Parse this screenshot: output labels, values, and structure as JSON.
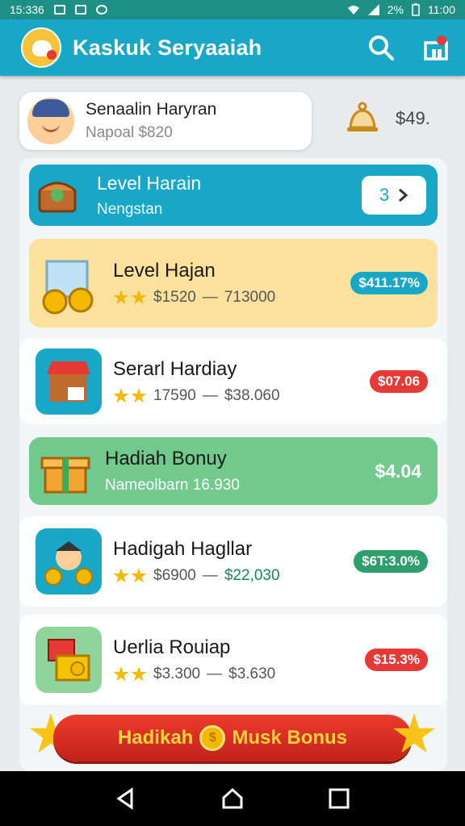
{
  "status_bar": {
    "time_left": "15:336",
    "battery": "2%",
    "time_right": "11:00"
  },
  "app_bar": {
    "title": "Kaskuk Seryaaiah"
  },
  "profile": {
    "name": "Senaalin Haryran",
    "subtitle": "Napoal $820"
  },
  "balance": {
    "value": "$49."
  },
  "rows": [
    {
      "title": "Level Harain",
      "subtitle": "Nengstan",
      "badge": "3",
      "bg": "#19a7c7"
    },
    {
      "title": "Level Hajan",
      "range_low": "$1520",
      "range_high": "713000",
      "pill": "$411.17%",
      "pill_color": "#19a7c7",
      "bg": "#fbe19b"
    },
    {
      "title": "Serarl Hardiay",
      "range_low": "17590",
      "range_high": "$38.060",
      "pill": "$07.06",
      "pill_color": "#e53935"
    },
    {
      "title": "Hadiah Bonuy",
      "subtitle": "Nameolbarn 16.930",
      "value": "$4.04",
      "bg": "#72c98d"
    },
    {
      "title": "Hadigah Hagllar",
      "range_low": "$6900",
      "range_high": "$22,030",
      "pill": "$6T:3.0%",
      "pill_color": "#2e9e6a"
    },
    {
      "title": "Uerlia Rouiap",
      "range_low": "$3.300",
      "range_high": "$3.630",
      "pill": "$15.3%",
      "pill_color": "#e53935"
    }
  ],
  "bonus_button": {
    "label_left": "Hadikah",
    "label_right": "Musk Bonus"
  },
  "colors": {
    "primary": "#19a7c7",
    "status_bar": "#1e8f84",
    "accent_red": "#e53935",
    "star": "#f5b800"
  }
}
